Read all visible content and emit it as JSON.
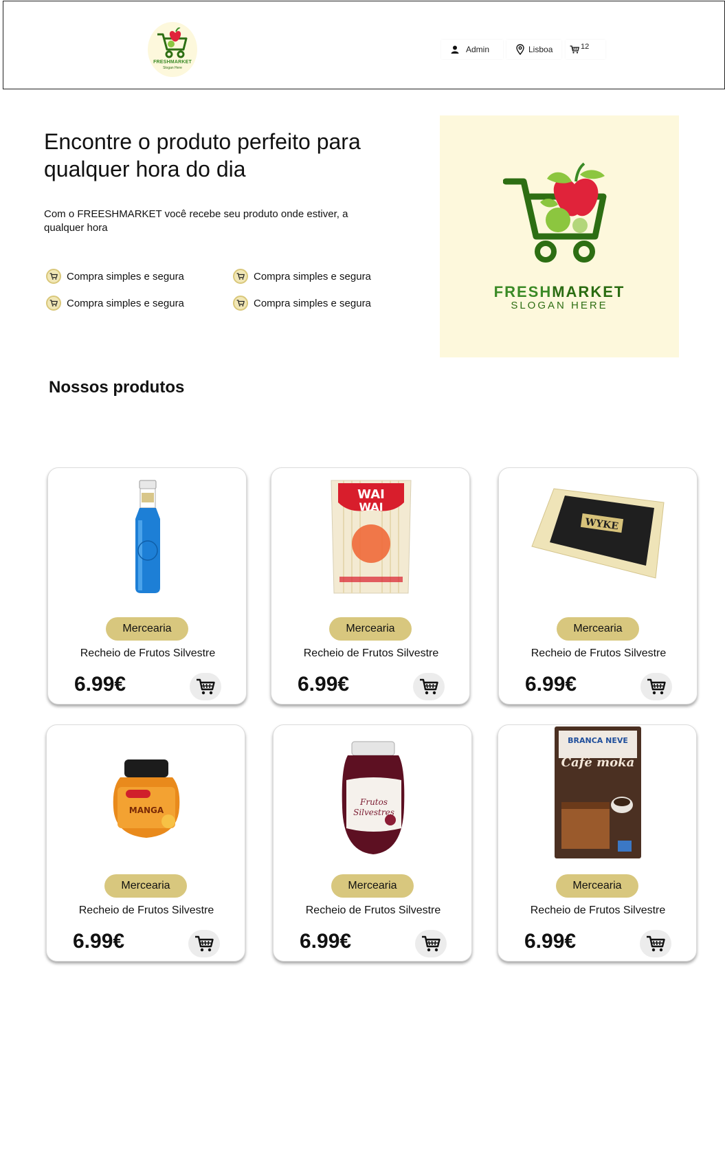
{
  "header": {
    "logo": {
      "name": "FRESHMARKET",
      "slogan": "Slogan Here"
    },
    "user_label": "Admin",
    "location_label": "Lisboa",
    "cart_count": "12"
  },
  "hero": {
    "title": "Encontre o produto perfeito para qualquer hora do dia",
    "subtitle": "Com o FREESHMARKET você recebe seu produto onde estiver, a qualquer hora",
    "features": [
      "Compra simples e segura",
      "Compra simples e segura",
      "Compra simples e segura",
      "Compra simples e segura"
    ],
    "logo": {
      "brand_part1": "FRESH",
      "brand_part2": "MARKET",
      "slogan": "SLOGAN HERE"
    }
  },
  "products_section": {
    "title": "Nossos produtos",
    "products": [
      {
        "image": "water-bottle-image",
        "category": "Mercearia",
        "name": "Recheio de Frutos Silvestre",
        "price": "6.99€"
      },
      {
        "image": "noodles-package-image",
        "category": "Mercearia",
        "name": "Recheio de Frutos Silvestre",
        "price": "6.99€"
      },
      {
        "image": "cheese-block-image",
        "category": "Mercearia",
        "name": "Recheio de Frutos Silvestre",
        "price": "6.99€"
      },
      {
        "image": "mango-jam-jar-image",
        "category": "Mercearia",
        "name": "Recheio de Frutos Silvestre",
        "price": "6.99€"
      },
      {
        "image": "berry-filling-jar-image",
        "category": "Mercearia",
        "name": "Recheio de Frutos Silvestre",
        "price": "6.99€"
      },
      {
        "image": "cake-mix-box-image",
        "category": "Mercearia",
        "name": "Recheio de Frutos Silvestre",
        "price": "6.99€"
      }
    ]
  },
  "colors": {
    "accent_badge": "#d8c77e",
    "brand_green": "#3a8a26",
    "brand_red": "#e0233a",
    "logo_bg": "#fdf8dc"
  }
}
